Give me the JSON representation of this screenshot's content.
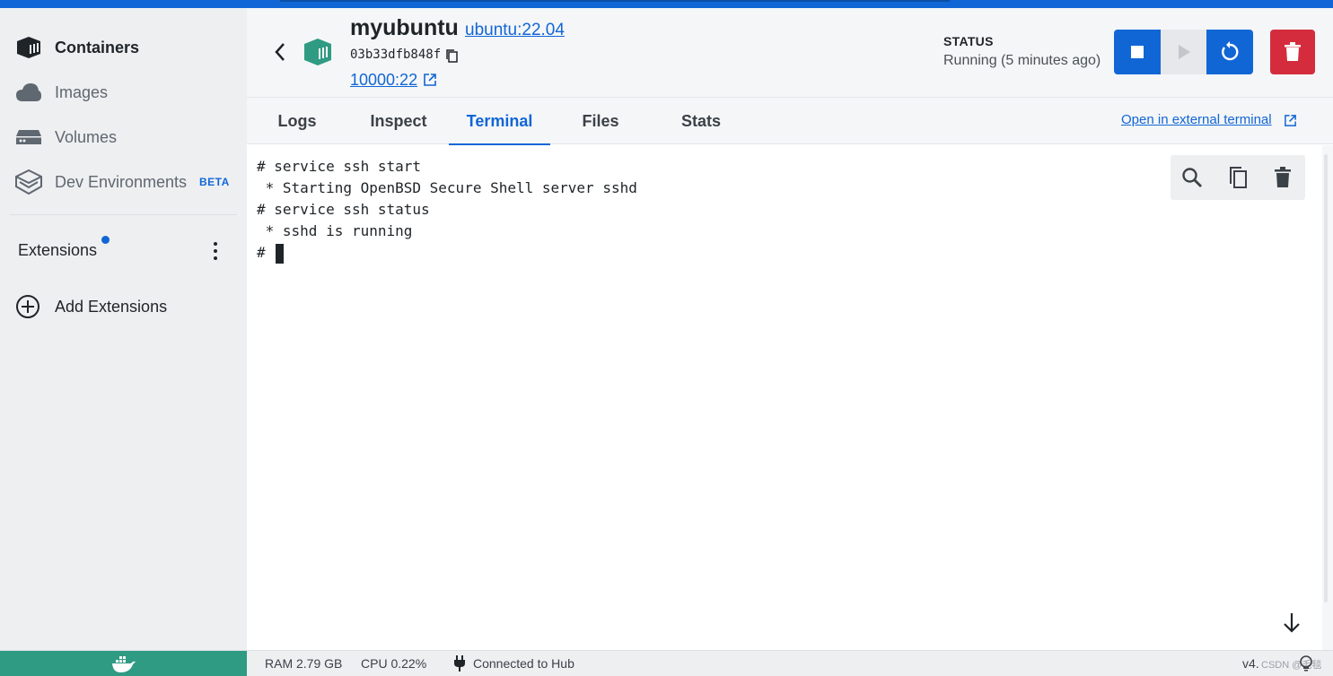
{
  "sidebar": {
    "items": [
      {
        "label": "Containers",
        "icon": "containers-icon"
      },
      {
        "label": "Images",
        "icon": "cloud-icon"
      },
      {
        "label": "Volumes",
        "icon": "volume-icon"
      },
      {
        "label": "Dev Environments",
        "icon": "dev-environments-icon",
        "badge": "BETA"
      }
    ],
    "extensions_label": "Extensions",
    "add_extensions_label": "Add Extensions"
  },
  "header": {
    "container_name": "myubuntu",
    "image_link": "ubuntu:22.04",
    "container_id": "03b33dfb848f",
    "port_link": "10000:22",
    "status_title": "STATUS",
    "status_value": "Running (5 minutes ago)"
  },
  "tabs": [
    {
      "label": "Logs"
    },
    {
      "label": "Inspect"
    },
    {
      "label": "Terminal",
      "active": true
    },
    {
      "label": "Files"
    },
    {
      "label": "Stats"
    }
  ],
  "open_external_terminal": "Open in external terminal",
  "terminal": {
    "lines": [
      "# service ssh start",
      " * Starting OpenBSD Secure Shell server sshd",
      "# service ssh status",
      " * sshd is running"
    ],
    "prompt": "# "
  },
  "footer": {
    "ram": "RAM 2.79 GB",
    "cpu": "CPU 0.22%",
    "hub": "Connected to Hub",
    "version": "v4.",
    "watermark": "CSDN @毛毯"
  },
  "colors": {
    "accent": "#1166d6",
    "danger": "#d42c3c",
    "whale_bar": "#2f9b83"
  }
}
